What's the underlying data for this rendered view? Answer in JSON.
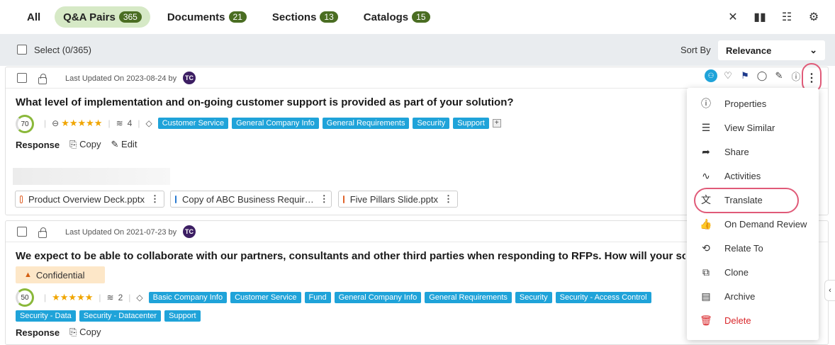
{
  "tabs": [
    {
      "label": "All"
    },
    {
      "label": "Q&A Pairs",
      "count": "365",
      "active": true
    },
    {
      "label": "Documents",
      "count": "21"
    },
    {
      "label": "Sections",
      "count": "13"
    },
    {
      "label": "Catalogs",
      "count": "15"
    }
  ],
  "top_icons": [
    "tools-icon",
    "bar-chart-icon",
    "filter-list-icon",
    "settings-icon"
  ],
  "selectbar": {
    "select_label": "Select (0/365)",
    "sort_label": "Sort By",
    "sort_value": "Relevance"
  },
  "cards": [
    {
      "updated": "Last Updated On 2023-08-24 by",
      "avatar": "TC",
      "question": "What level of implementation and on-going customer support is provided as part of your solution?",
      "score": "70",
      "count": "4",
      "tags": [
        "Customer Service",
        "General Company Info",
        "General Requirements",
        "Security",
        "Support"
      ],
      "response_label": "Response",
      "copy_label": "Copy",
      "edit_label": "Edit",
      "files": [
        "Product Overview Deck.pptx",
        "Copy of ABC Business Requir…",
        "Five Pillars Slide.pptx"
      ]
    },
    {
      "updated": "Last Updated On 2021-07-23 by",
      "avatar": "TC",
      "question": "We expect to be able to collaborate with our partners, consultants and other third parties when responding to RFPs. How will your solution",
      "confidential": "Confidential",
      "score": "50",
      "count": "2",
      "tags_row1": [
        "Basic Company Info",
        "Customer Service",
        "Fund",
        "General Company Info",
        "General Requirements",
        "Security",
        "Security - Access Control"
      ],
      "tags_row2": [
        "Security - Data",
        "Security - Datacenter",
        "Support"
      ],
      "response_label": "Response",
      "copy_label": "Copy"
    }
  ],
  "menu": {
    "items": [
      {
        "label": "Properties",
        "icon": "info-icon"
      },
      {
        "label": "View Similar",
        "icon": "document-icon"
      },
      {
        "label": "Share",
        "icon": "share-icon"
      },
      {
        "label": "Activities",
        "icon": "activity-icon"
      },
      {
        "label": "Translate",
        "icon": "translate-icon"
      },
      {
        "label": "On Demand Review",
        "icon": "thumbs-up-icon"
      },
      {
        "label": "Relate To",
        "icon": "relate-icon"
      },
      {
        "label": "Clone",
        "icon": "clone-icon"
      },
      {
        "label": "Archive",
        "icon": "archive-icon"
      },
      {
        "label": "Delete",
        "icon": "trash-icon",
        "danger": true
      }
    ]
  },
  "colors": {
    "accent_green": "#4a6d22",
    "active_tab_bg": "#d6e9c6",
    "tag_blue": "#1fa3d9",
    "highlight_ring": "#e05a78",
    "delete_red": "#d9262a",
    "avatar_purple": "#3c1e63"
  }
}
